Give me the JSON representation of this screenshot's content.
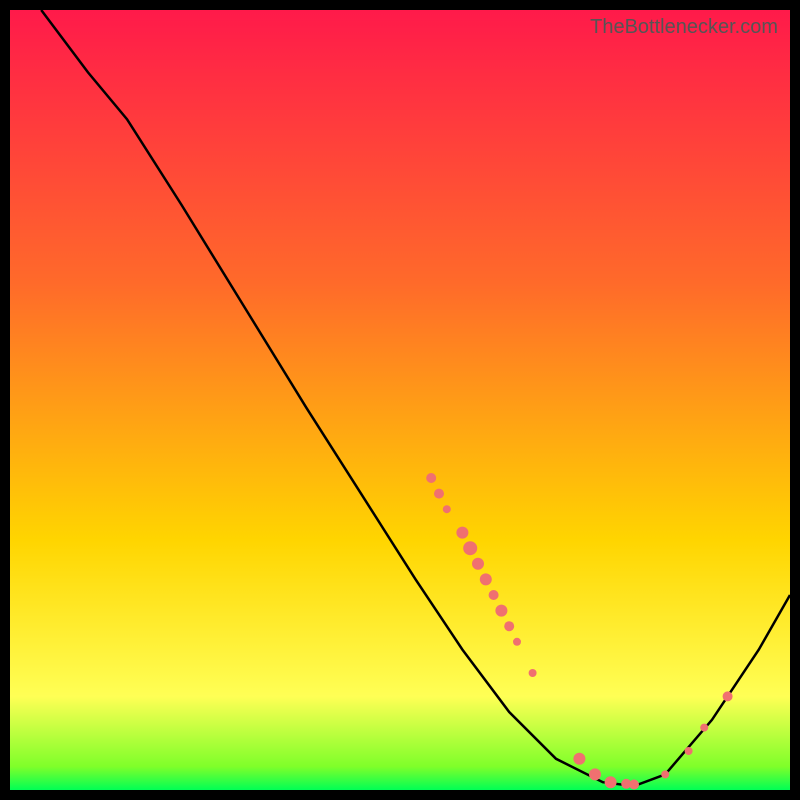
{
  "watermark": "TheBottlenecker.com",
  "chart_data": {
    "type": "line",
    "title": "",
    "xlabel": "",
    "ylabel": "",
    "xlim": [
      0,
      100
    ],
    "ylim": [
      0,
      100
    ],
    "gradient_stops": [
      {
        "offset": 0,
        "color": "#ff1a4a"
      },
      {
        "offset": 0.35,
        "color": "#ff6a2a"
      },
      {
        "offset": 0.68,
        "color": "#ffd500"
      },
      {
        "offset": 0.88,
        "color": "#ffff55"
      },
      {
        "offset": 0.97,
        "color": "#7fff2a"
      },
      {
        "offset": 1.0,
        "color": "#00ff55"
      }
    ],
    "curve": [
      {
        "x": 4,
        "y": 100
      },
      {
        "x": 10,
        "y": 92
      },
      {
        "x": 15,
        "y": 86
      },
      {
        "x": 22,
        "y": 75
      },
      {
        "x": 30,
        "y": 62
      },
      {
        "x": 38,
        "y": 49
      },
      {
        "x": 45,
        "y": 38
      },
      {
        "x": 52,
        "y": 27
      },
      {
        "x": 58,
        "y": 18
      },
      {
        "x": 64,
        "y": 10
      },
      {
        "x": 70,
        "y": 4
      },
      {
        "x": 76,
        "y": 1
      },
      {
        "x": 80,
        "y": 0.5
      },
      {
        "x": 84,
        "y": 2
      },
      {
        "x": 90,
        "y": 9
      },
      {
        "x": 96,
        "y": 18
      },
      {
        "x": 100,
        "y": 25
      }
    ],
    "scatter_points": [
      {
        "x": 54,
        "y": 40,
        "r": 5
      },
      {
        "x": 55,
        "y": 38,
        "r": 5
      },
      {
        "x": 56,
        "y": 36,
        "r": 4
      },
      {
        "x": 58,
        "y": 33,
        "r": 6
      },
      {
        "x": 59,
        "y": 31,
        "r": 7
      },
      {
        "x": 60,
        "y": 29,
        "r": 6
      },
      {
        "x": 61,
        "y": 27,
        "r": 6
      },
      {
        "x": 62,
        "y": 25,
        "r": 5
      },
      {
        "x": 63,
        "y": 23,
        "r": 6
      },
      {
        "x": 64,
        "y": 21,
        "r": 5
      },
      {
        "x": 65,
        "y": 19,
        "r": 4
      },
      {
        "x": 67,
        "y": 15,
        "r": 4
      },
      {
        "x": 73,
        "y": 4,
        "r": 6
      },
      {
        "x": 75,
        "y": 2,
        "r": 6
      },
      {
        "x": 77,
        "y": 1,
        "r": 6
      },
      {
        "x": 79,
        "y": 0.8,
        "r": 5
      },
      {
        "x": 80,
        "y": 0.7,
        "r": 5
      },
      {
        "x": 84,
        "y": 2,
        "r": 4
      },
      {
        "x": 87,
        "y": 5,
        "r": 4
      },
      {
        "x": 89,
        "y": 8,
        "r": 4
      },
      {
        "x": 92,
        "y": 12,
        "r": 5
      }
    ],
    "point_color": "#f07070"
  }
}
